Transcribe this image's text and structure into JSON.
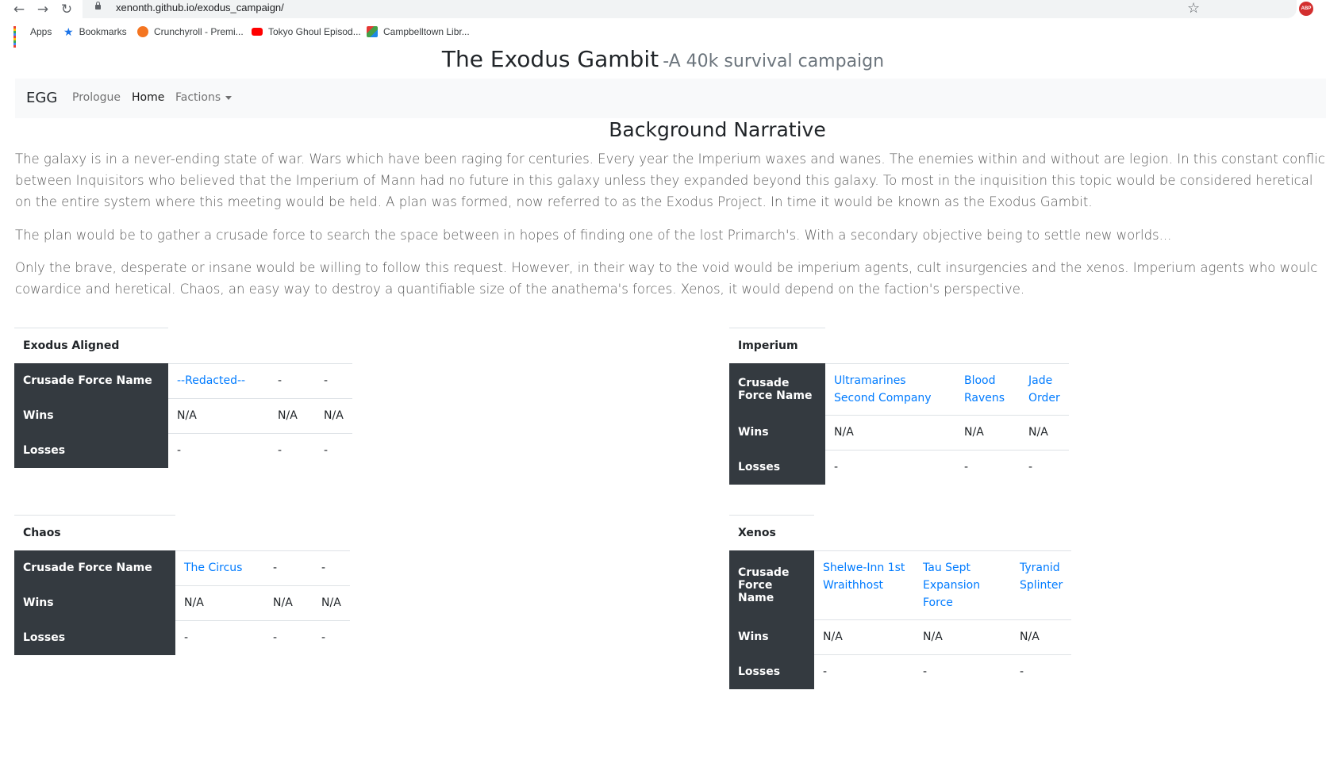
{
  "browser": {
    "url": "xenonth.github.io/exodus_campaign/",
    "bookmarks": [
      {
        "label": "Apps",
        "icon": "apps-grid-icon"
      },
      {
        "label": "Bookmarks",
        "icon": "star-icon"
      },
      {
        "label": "Crunchyroll - Premi...",
        "icon": "crunchyroll-icon"
      },
      {
        "label": "Tokyo Ghoul Episod...",
        "icon": "youtube-icon"
      },
      {
        "label": "Campbelltown Libr...",
        "icon": "library-icon"
      }
    ],
    "extension_badge": "ABP"
  },
  "site": {
    "title": "The Exodus Gambit",
    "subtitle": "-A 40k survival campaign"
  },
  "nav": {
    "brand": "EGG",
    "links": [
      "Prologue",
      "Home",
      "Factions"
    ],
    "active": "Home"
  },
  "narrative": {
    "heading": "Background Narrative",
    "lines": [
      "The galaxy is in a never-ending state of war. Wars which have been raging for centuries. Every year the Imperium waxes and wanes. The enemies within and without are legion. In this constant conflic",
      "between Inquisitors who believed that the Imperium of Mann had no future in this galaxy unless they expanded beyond this galaxy. To most in the inquisition this topic would be considered heretical",
      "on the entire system where this meeting would be held. A plan was formed, now referred to as the Exodus Project. In time it would be known as the Exodus Gambit.",
      "The plan would be to gather a crusade force to search the space between in hopes of finding one of the lost Primarch's. With a secondary objective being to settle new worlds...",
      "Only the brave, desperate or insane would be willing to follow this request. However, in their way to the void would be imperium agents, cult insurgencies and the xenos. Imperium agents who woulc",
      "cowardice and heretical. Chaos, an easy way to destroy a quantifiable size of the anathema's forces. Xenos, it would depend on the faction's perspective."
    ]
  },
  "factions": {
    "row_labels": {
      "name_long": "Crusade Force Name",
      "name_line1": "Crusade",
      "name_line2": "Force Name",
      "wins": "Wins",
      "losses": "Losses"
    },
    "exodus": {
      "caption": "Exodus Aligned",
      "forces": [
        "--Redacted--",
        "-",
        "-"
      ],
      "wins": [
        "N/A",
        "N/A",
        "N/A"
      ],
      "losses": [
        "-",
        "-",
        "-"
      ]
    },
    "imperium": {
      "caption": "Imperium",
      "forces": [
        "Ultramarines Second Company",
        "Blood Ravens",
        "Jade Order"
      ],
      "wins": [
        "N/A",
        "N/A",
        "N/A"
      ],
      "losses": [
        "-",
        "-",
        "-"
      ]
    },
    "chaos": {
      "caption": "Chaos",
      "forces": [
        "The Circus",
        "-",
        "-"
      ],
      "wins": [
        "N/A",
        "N/A",
        "N/A"
      ],
      "losses": [
        "-",
        "-",
        "-"
      ]
    },
    "xenos": {
      "caption": "Xenos",
      "forces": [
        "Shelwe-Inn 1st Wraithhost",
        "Tau Sept Expansion Force",
        "Tyranid Splinter"
      ],
      "wins": [
        "N/A",
        "N/A",
        "N/A"
      ],
      "losses": [
        "-",
        "-",
        "-"
      ]
    }
  }
}
